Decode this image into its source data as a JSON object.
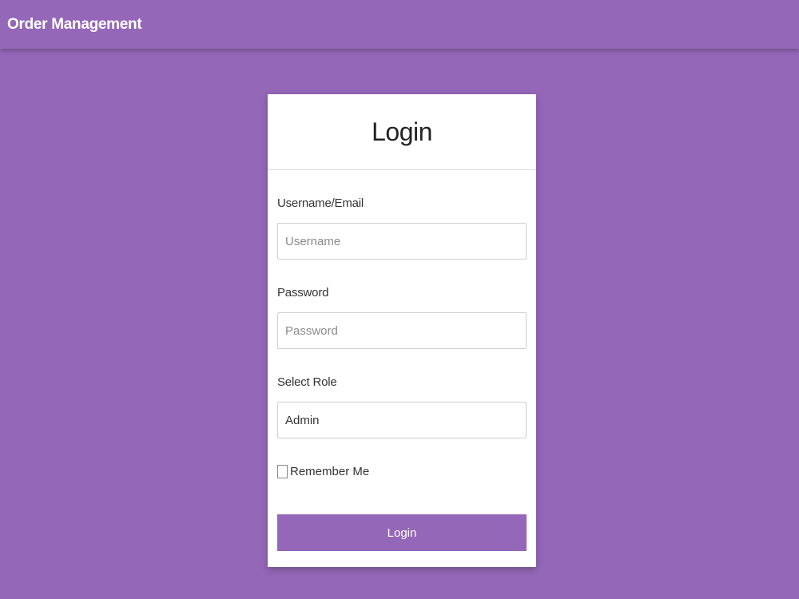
{
  "navbar": {
    "brand": "Order Management"
  },
  "login_card": {
    "title": "Login",
    "username": {
      "label": "Username/Email",
      "placeholder": "Username",
      "value": ""
    },
    "password": {
      "label": "Password",
      "placeholder": "Password",
      "value": ""
    },
    "role": {
      "label": "Select Role",
      "selected": "Admin"
    },
    "remember_me": {
      "label": "Remember Me",
      "checked": false
    },
    "submit_label": "Login"
  },
  "colors": {
    "accent": "#9467b8",
    "card_background": "#ffffff",
    "text": "#333333"
  }
}
